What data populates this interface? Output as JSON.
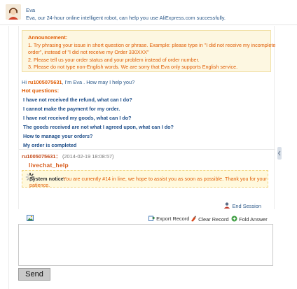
{
  "header": {
    "name": "Eva",
    "intro": "Eva, our 24-hour online intelligent robot, can help you use AliExpress.com successfully."
  },
  "announcement": {
    "title": "Announcement:",
    "lines": [
      "1. Try phrasing your issue in short question or phrase. Example: please type in \"I did not receive my incomplete",
      "order\", instead of \"I did not receive my Order 330XXX\"",
      "2. Please tell us your order status and your problem instead of order number.",
      "3. Please do not type non-English words. We are sorry that Eva only supports English service."
    ]
  },
  "greeting": {
    "prefix": "Hi",
    "user_id": "ru1005075631",
    "suffix": ", I'm Eva . How may I help you?"
  },
  "hot_questions": {
    "title": "Hot questions:",
    "items": [
      "I have not received the refund, what can I do?",
      "I cannot make the payment for my order.",
      "I have not received my goods, what can I do?",
      "The goods received are not what I agreed upon, what can I do?",
      "How to manage your orders?",
      "My order is completed"
    ]
  },
  "message": {
    "user_id": "ru1005075631",
    "separator": "：",
    "time": "(2014-02-19 18:08:57)",
    "text": "livechat_help"
  },
  "notice": {
    "label": "System notice:",
    "text_line1": "You are currently #14 in line, we hope to assist you as soon as possible. Thank you for your",
    "text_line2": "patience."
  },
  "end_session_label": "End Session",
  "toolbar": {
    "export_label": "Export Record",
    "clear_label": "Clear Record",
    "fold_label": "Fold Answer"
  },
  "input": {
    "value": "",
    "placeholder": ""
  },
  "send_label": "Send",
  "colors": {
    "link_blue": "#1f4f8a",
    "orange": "#e05d05",
    "announce_bg": "#fdf7e1"
  },
  "icons": {
    "avatar": "agent-avatar",
    "spinner": "loading-spinner-icon",
    "export": "export-icon",
    "clear": "clear-icon",
    "fold": "fold-icon",
    "end_session": "end-session-icon",
    "image": "image-icon"
  }
}
